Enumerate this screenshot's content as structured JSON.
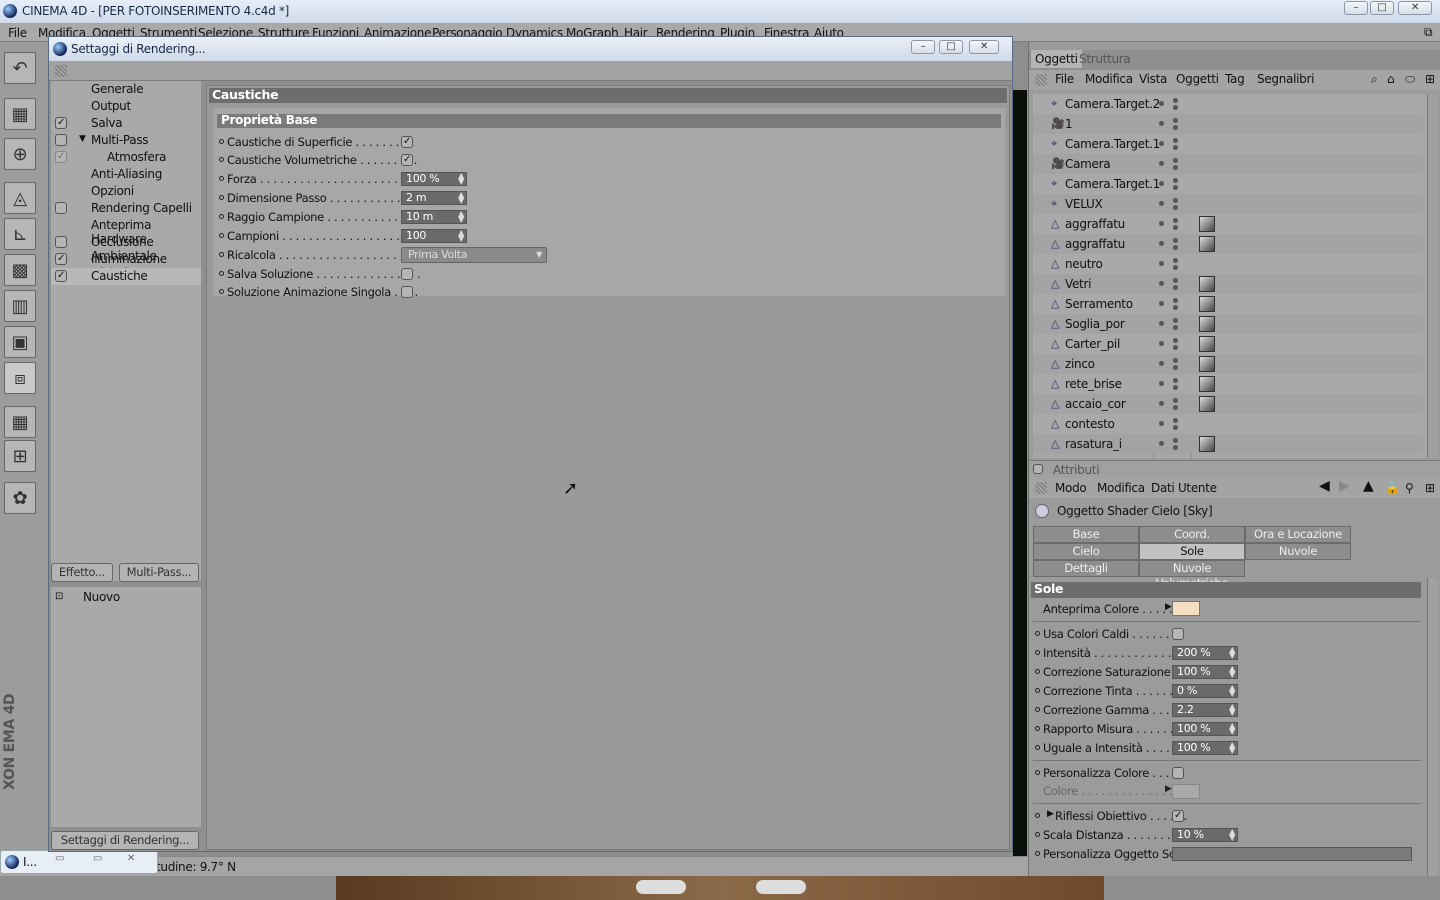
{
  "app": {
    "title": "CINEMA 4D - [PER FOTOINSERIMENTO 4.c4d *]"
  },
  "menu": [
    "File",
    "Modifica",
    "Oggetti",
    "Strumenti",
    "Selezione",
    "Strutture",
    "Funzioni",
    "Animazione",
    "Personaggio",
    "Dynamics",
    "MoGraph",
    "Hair",
    "Rendering",
    "Plugin",
    "Finestra",
    "Aiuto"
  ],
  "brand": "XON EMA 4D",
  "status": {
    "text": "tudine: 9.7° N",
    "task": "I..."
  },
  "dialog": {
    "title": "Settaggi di Rendering...",
    "items": [
      {
        "label": "Generale",
        "check": ""
      },
      {
        "label": "Output",
        "check": ""
      },
      {
        "label": "Salva",
        "check": "✓"
      },
      {
        "label": "Multi-Pass",
        "check": " "
      },
      {
        "label": "Atmosfera",
        "check": "✓"
      },
      {
        "label": "Anti-Aliasing",
        "check": ""
      },
      {
        "label": "Opzioni",
        "check": ""
      },
      {
        "label": "Rendering Capelli",
        "check": " "
      },
      {
        "label": "Anteprima Hardware",
        "check": ""
      },
      {
        "label": "Occlusione Ambientale",
        "check": " "
      },
      {
        "label": "Illuminazione Globale",
        "check": "✓"
      },
      {
        "label": "Caustiche",
        "check": "✓"
      }
    ],
    "effect_button": "Effetto...",
    "multipass_button": "Multi-Pass...",
    "preset_new": "Nuovo",
    "bottom_tab": "Settaggi di Rendering...",
    "section": "Caustiche",
    "subsection": "Proprietà Base",
    "props": {
      "surface": {
        "label": "Caustiche di Superficie . . . . . . . . .",
        "checked": "✓"
      },
      "volumetric": {
        "label": "Caustiche Volumetriche . . . . . . . . .",
        "checked": "✓"
      },
      "forza": {
        "label": "Forza . . . . . . . . . . . . . . . . . . . . . . . .",
        "value": "100 %"
      },
      "dimensione": {
        "label": "Dimensione Passo . . . . . . . . . . . . . .",
        "value": "2 m"
      },
      "raggio": {
        "label": "Raggio Campione . . . . . . . . . . . . . .",
        "value": "10 m"
      },
      "campioni": {
        "label": "Campioni . . . . . . . . . . . . . . . . . . . . .",
        "value": "100"
      },
      "ricalcola": {
        "label": "Ricalcola . . . . . . . . . . . . . . . . . . . . .",
        "value": "Prima Volta"
      },
      "salva": {
        "label": "Salva Soluzione . . . . . . . . . . . . . . . .",
        "checked": ""
      },
      "soluzione": {
        "label": "Soluzione Animazione Singola . . . .",
        "checked": ""
      }
    }
  },
  "objects": {
    "tab_active": "Oggetti",
    "tab_other": "Struttura",
    "toolbar": [
      "File",
      "Modifica",
      "Vista",
      "Oggetti",
      "Tag",
      "Segnalibri"
    ],
    "rows": [
      {
        "name": "Camera.Target.2",
        "icon": "⌖",
        "tex": false
      },
      {
        "name": "1",
        "icon": "🎥",
        "tex": false
      },
      {
        "name": "Camera.Target.1",
        "icon": "⌖",
        "tex": false
      },
      {
        "name": "Camera",
        "icon": "🎥",
        "tex": false
      },
      {
        "name": "Camera.Target.1",
        "icon": "⌖",
        "tex": false
      },
      {
        "name": "VELUX",
        "icon": "⌖",
        "tex": false
      },
      {
        "name": "aggraffatu",
        "icon": "△",
        "tex": true
      },
      {
        "name": "aggraffatu",
        "icon": "△",
        "tex": true
      },
      {
        "name": "neutro",
        "icon": "△",
        "tex": false
      },
      {
        "name": "Vetri",
        "icon": "△",
        "tex": true
      },
      {
        "name": "Serramento",
        "icon": "△",
        "tex": true
      },
      {
        "name": "Soglia_por",
        "icon": "△",
        "tex": true
      },
      {
        "name": "Carter_pil",
        "icon": "△",
        "tex": true
      },
      {
        "name": "zinco",
        "icon": "△",
        "tex": true
      },
      {
        "name": "rete_brise",
        "icon": "△",
        "tex": true
      },
      {
        "name": "accaio_cor",
        "icon": "△",
        "tex": true
      },
      {
        "name": "contesto",
        "icon": "△",
        "tex": false
      },
      {
        "name": "rasatura_i",
        "icon": "△",
        "tex": true
      }
    ]
  },
  "attributes": {
    "header": "Attributi",
    "toolbar": [
      "Modo",
      "Modifica",
      "Dati Utente"
    ],
    "object_title": "Oggetto Shader Cielo [Sky]",
    "tabs_row1": [
      "Base",
      "Coord.",
      "Ora e Locazione"
    ],
    "tabs_row2": [
      "Cielo",
      "Sole",
      "Nuvole"
    ],
    "tabs_row3": [
      "Dettagli",
      "Nuvole Volumetriche"
    ],
    "section": "Sole",
    "anteprima": "Anteprima Colore . . . . .",
    "usa_colori": "Usa Colori Caldi . . . . . . . .",
    "fields": [
      {
        "label": "Intensità . . . . . . . . . . . . . .",
        "value": "200 %"
      },
      {
        "label": "Correzione Saturazione . . .",
        "value": "100 %"
      },
      {
        "label": "Correzione Tinta . . . . . . . .",
        "value": "0 %"
      },
      {
        "label": "Correzione Gamma . . . . .",
        "value": "2.2"
      },
      {
        "label": "Rapporto Misura . . . . . . . .",
        "value": "100 %"
      },
      {
        "label": "Uguale a Intensità . . . . . .",
        "value": "100 %"
      }
    ],
    "personalizza_colore": "Personalizza Colore . . . . .",
    "colore": "Colore . . . . . . . . . . . . . . .",
    "riflessi": "Riflessi Obiettivo . . . . . .",
    "scala_distanza": {
      "label": "Scala Distanza . . . . . . . .",
      "value": "10 %"
    },
    "personalizza_oggetto": "Personalizza Oggetto Sole"
  },
  "colors": {
    "accent_field": "#6a6a6a",
    "section_head": "#6d6d6d",
    "swatch": "#f6dec0"
  }
}
